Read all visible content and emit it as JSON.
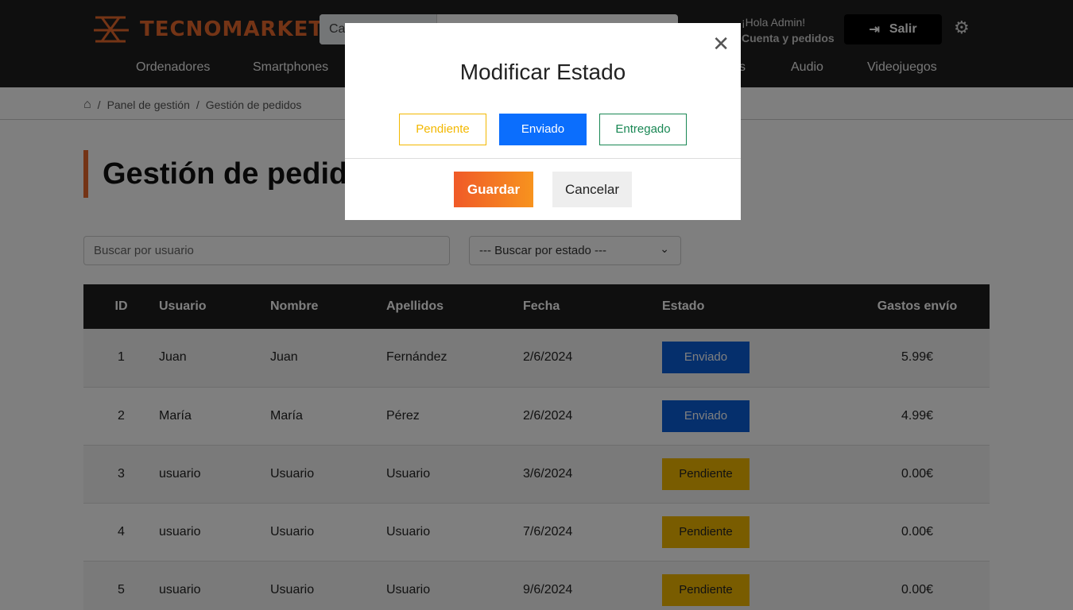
{
  "header": {
    "logo_text": "TECNOMARKET",
    "search_category": "Ca",
    "greeting": "¡Hola Admin!",
    "account_link": "Cuenta y pedidos",
    "logout_label": "Salir",
    "nav": [
      "Ordenadores",
      "Smartphones",
      "s",
      "Audio",
      "Videojuegos"
    ]
  },
  "breadcrumb": [
    "Panel de gestión",
    "Gestión de pedidos"
  ],
  "page_title": "Gestión de pedidos",
  "filters": {
    "user_placeholder": "Buscar por usuario",
    "state_selected": "--- Buscar por estado ---"
  },
  "table": {
    "headers": [
      "ID",
      "Usuario",
      "Nombre",
      "Apellidos",
      "Fecha",
      "Estado",
      "Gastos envío"
    ],
    "rows": [
      {
        "id": "1",
        "usuario": "Juan",
        "nombre": "Juan",
        "apellidos": "Fernández",
        "fecha": "2/6/2024",
        "estado": "Enviado",
        "gastos": "5.99€"
      },
      {
        "id": "2",
        "usuario": "María",
        "nombre": "María",
        "apellidos": "Pérez",
        "fecha": "2/6/2024",
        "estado": "Enviado",
        "gastos": "4.99€"
      },
      {
        "id": "3",
        "usuario": "usuario",
        "nombre": "Usuario",
        "apellidos": "Usuario",
        "fecha": "3/6/2024",
        "estado": "Pendiente",
        "gastos": "0.00€"
      },
      {
        "id": "4",
        "usuario": "usuario",
        "nombre": "Usuario",
        "apellidos": "Usuario",
        "fecha": "7/6/2024",
        "estado": "Pendiente",
        "gastos": "0.00€"
      },
      {
        "id": "5",
        "usuario": "usuario",
        "nombre": "Usuario",
        "apellidos": "Usuario",
        "fecha": "9/6/2024",
        "estado": "Pendiente",
        "gastos": "0.00€"
      }
    ]
  },
  "modal": {
    "title": "Modificar Estado",
    "options": [
      "Pendiente",
      "Enviado",
      "Entregado"
    ],
    "selected": "Enviado",
    "save_label": "Guardar",
    "cancel_label": "Cancelar"
  },
  "colors": {
    "accent": "#e8692c",
    "enviado": "#0b5fd8",
    "pendiente": "#f3b800",
    "entregado": "#198754"
  }
}
